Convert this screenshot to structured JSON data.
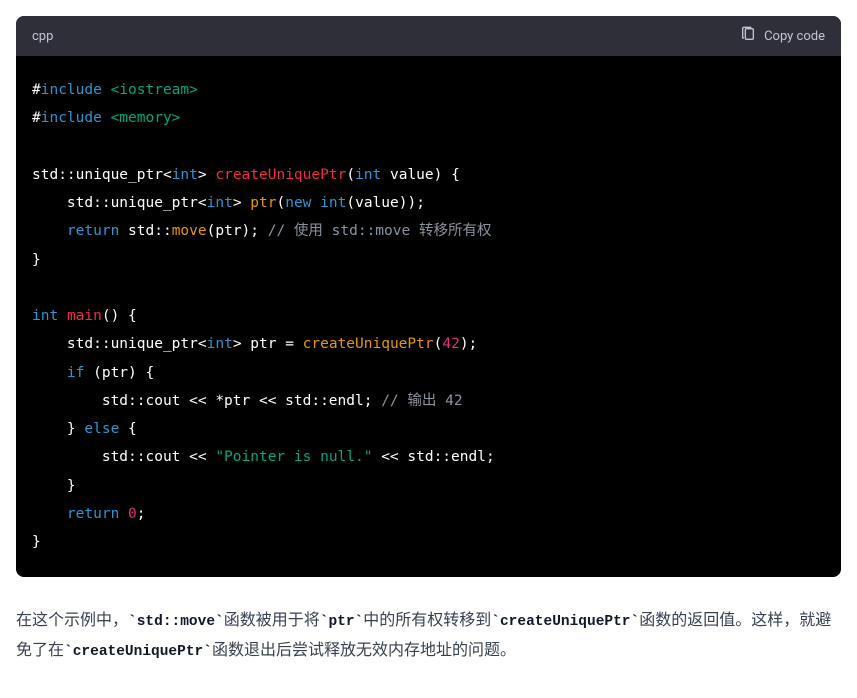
{
  "header": {
    "language": "cpp",
    "copy_label": "Copy code"
  },
  "code": {
    "lines": [
      [
        {
          "t": "#",
          "c": "tok-white"
        },
        {
          "t": "include",
          "c": "tok-kw"
        },
        {
          "t": " ",
          "c": "tok-white"
        },
        {
          "t": "<iostream>",
          "c": "tok-include-path"
        }
      ],
      [
        {
          "t": "#",
          "c": "tok-white"
        },
        {
          "t": "include",
          "c": "tok-kw"
        },
        {
          "t": " ",
          "c": "tok-white"
        },
        {
          "t": "<memory>",
          "c": "tok-include-path"
        }
      ],
      [],
      [
        {
          "t": "std::unique_ptr<",
          "c": "tok-white"
        },
        {
          "t": "int",
          "c": "tok-type"
        },
        {
          "t": "> ",
          "c": "tok-white"
        },
        {
          "t": "createUniquePtr",
          "c": "tok-fn"
        },
        {
          "t": "(",
          "c": "tok-white"
        },
        {
          "t": "int",
          "c": "tok-type"
        },
        {
          "t": " value) {",
          "c": "tok-white"
        }
      ],
      [
        {
          "t": "    std::unique_ptr<",
          "c": "tok-white"
        },
        {
          "t": "int",
          "c": "tok-type"
        },
        {
          "t": "> ",
          "c": "tok-white"
        },
        {
          "t": "ptr",
          "c": "tok-call"
        },
        {
          "t": "(",
          "c": "tok-white"
        },
        {
          "t": "new",
          "c": "tok-kw"
        },
        {
          "t": " ",
          "c": "tok-white"
        },
        {
          "t": "int",
          "c": "tok-type"
        },
        {
          "t": "(value));",
          "c": "tok-white"
        }
      ],
      [
        {
          "t": "    ",
          "c": "tok-white"
        },
        {
          "t": "return",
          "c": "tok-kw"
        },
        {
          "t": " std::",
          "c": "tok-white"
        },
        {
          "t": "move",
          "c": "tok-call"
        },
        {
          "t": "(ptr); ",
          "c": "tok-white"
        },
        {
          "t": "// 使用 std::move 转移所有权",
          "c": "tok-comment"
        }
      ],
      [
        {
          "t": "}",
          "c": "tok-white"
        }
      ],
      [],
      [
        {
          "t": "int",
          "c": "tok-type"
        },
        {
          "t": " ",
          "c": "tok-white"
        },
        {
          "t": "main",
          "c": "tok-fn"
        },
        {
          "t": "() {",
          "c": "tok-white"
        }
      ],
      [
        {
          "t": "    std::unique_ptr<",
          "c": "tok-white"
        },
        {
          "t": "int",
          "c": "tok-type"
        },
        {
          "t": "> ptr = ",
          "c": "tok-white"
        },
        {
          "t": "createUniquePtr",
          "c": "tok-call"
        },
        {
          "t": "(",
          "c": "tok-white"
        },
        {
          "t": "42",
          "c": "tok-num"
        },
        {
          "t": ");",
          "c": "tok-white"
        }
      ],
      [
        {
          "t": "    ",
          "c": "tok-white"
        },
        {
          "t": "if",
          "c": "tok-kw"
        },
        {
          "t": " (ptr) {",
          "c": "tok-white"
        }
      ],
      [
        {
          "t": "        std::cout << *ptr << std::endl; ",
          "c": "tok-white"
        },
        {
          "t": "// 输出 42",
          "c": "tok-comment"
        }
      ],
      [
        {
          "t": "    } ",
          "c": "tok-white"
        },
        {
          "t": "else",
          "c": "tok-kw"
        },
        {
          "t": " {",
          "c": "tok-white"
        }
      ],
      [
        {
          "t": "        std::cout << ",
          "c": "tok-white"
        },
        {
          "t": "\"Pointer is null.\"",
          "c": "tok-str"
        },
        {
          "t": " << std::endl;",
          "c": "tok-white"
        }
      ],
      [
        {
          "t": "    }",
          "c": "tok-white"
        }
      ],
      [
        {
          "t": "    ",
          "c": "tok-white"
        },
        {
          "t": "return",
          "c": "tok-kw"
        },
        {
          "t": " ",
          "c": "tok-white"
        },
        {
          "t": "0",
          "c": "tok-num"
        },
        {
          "t": ";",
          "c": "tok-white"
        }
      ],
      [
        {
          "t": "}",
          "c": "tok-white"
        }
      ]
    ]
  },
  "prose": {
    "segments": [
      {
        "t": "在这个示例中，",
        "code": false
      },
      {
        "t": "`std::move`",
        "code": true
      },
      {
        "t": "函数被用于将",
        "code": false
      },
      {
        "t": "`ptr`",
        "code": true
      },
      {
        "t": "中的所有权转移到",
        "code": false
      },
      {
        "t": "`createUniquePtr`",
        "code": true
      },
      {
        "t": "函数的返回值。这样，就避免了在",
        "code": false
      },
      {
        "t": "`createUniquePtr`",
        "code": true
      },
      {
        "t": "函数退出后尝试释放无效内存地址的问题。",
        "code": false
      }
    ]
  }
}
